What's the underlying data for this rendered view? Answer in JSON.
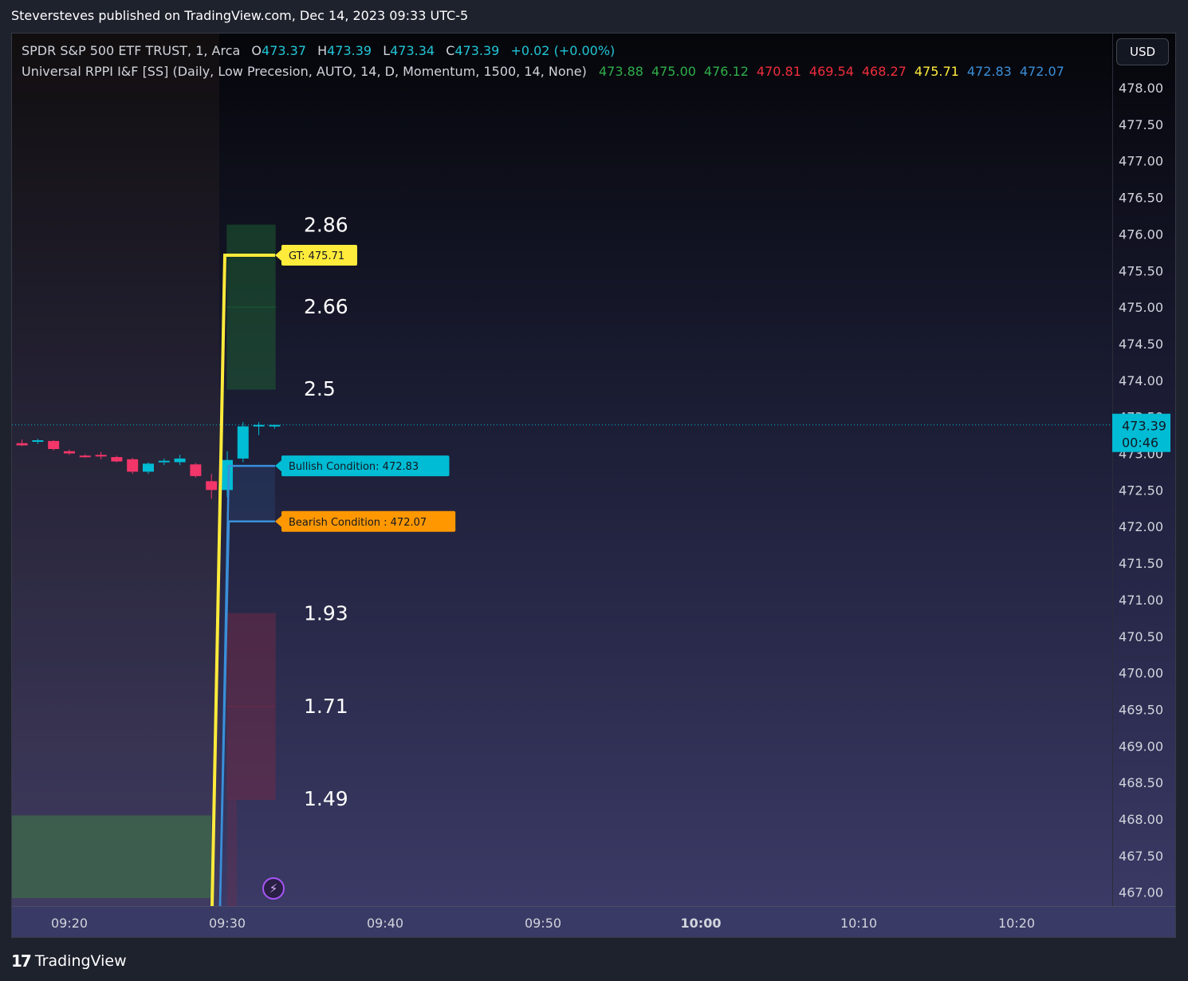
{
  "header": "Steversteves published on TradingView.com, Dec 14, 2023 09:33 UTC-5",
  "footer_brand": "TradingView",
  "footer_logo": "17",
  "currency_button": "USD",
  "legend": {
    "symbol": "SPDR S&P 500 ETF TRUST, 1, Arca",
    "open_label": "O",
    "open": "473.37",
    "high_label": "H",
    "high": "473.39",
    "low_label": "L",
    "low": "473.34",
    "close_label": "C",
    "close": "473.39",
    "change": "+0.02 (+0.00%)",
    "indicator_name": "Universal RPPI I&F [SS] (Daily, Low Precesion, AUTO, 14, D, Momentum, 1500, 14, None)",
    "indicator_values": [
      {
        "text": "473.88",
        "color": "#2fae4a"
      },
      {
        "text": "475.00",
        "color": "#2fae4a"
      },
      {
        "text": "476.12",
        "color": "#2fae4a"
      },
      {
        "text": "470.81",
        "color": "#ef2d3c"
      },
      {
        "text": "469.54",
        "color": "#ef2d3c"
      },
      {
        "text": "468.27",
        "color": "#ef2d3c"
      },
      {
        "text": "475.71",
        "color": "#ffeb3b"
      },
      {
        "text": "472.83",
        "color": "#3a8fd9"
      },
      {
        "text": "472.07",
        "color": "#3a8fd9"
      }
    ]
  },
  "last_price": {
    "price": "473.39",
    "countdown": "00:46",
    "value": 473.39
  },
  "chart_data": {
    "type": "candlestick",
    "ylim": [
      466.8,
      478.35
    ],
    "y_ticks": [
      478.0,
      477.5,
      477.0,
      476.5,
      476.0,
      475.5,
      475.0,
      474.5,
      474.0,
      473.5,
      473.0,
      472.5,
      472.0,
      471.5,
      471.0,
      470.5,
      470.0,
      469.5,
      469.0,
      468.5,
      468.0,
      467.5,
      467.0
    ],
    "y_tick_labels": [
      "478.00",
      "477.50",
      "477.00",
      "476.50",
      "476.00",
      "475.50",
      "475.00",
      "474.50",
      "474.00",
      "473.50",
      "473.00",
      "472.50",
      "472.00",
      "471.50",
      "471.00",
      "470.50",
      "470.00",
      "469.50",
      "469.00",
      "468.50",
      "468.00",
      "467.50",
      "467.00"
    ],
    "x_ticks": [
      "09:20",
      "09:30",
      "09:40",
      "09:50",
      "10:00",
      "10:10",
      "10:20"
    ],
    "bold_x_tick": "10:00",
    "candles": [
      {
        "t": "09:17",
        "o": 473.14,
        "h": 473.19,
        "l": 473.1,
        "c": 473.11
      },
      {
        "t": "09:18",
        "o": 473.16,
        "h": 473.2,
        "l": 473.13,
        "c": 473.18
      },
      {
        "t": "09:19",
        "o": 473.17,
        "h": 473.18,
        "l": 473.04,
        "c": 473.06
      },
      {
        "t": "09:20",
        "o": 473.03,
        "h": 473.05,
        "l": 472.98,
        "c": 473.0
      },
      {
        "t": "09:21",
        "o": 472.97,
        "h": 472.99,
        "l": 472.94,
        "c": 472.95
      },
      {
        "t": "09:22",
        "o": 472.98,
        "h": 473.02,
        "l": 472.92,
        "c": 472.96
      },
      {
        "t": "09:23",
        "o": 472.95,
        "h": 472.97,
        "l": 472.88,
        "c": 472.89
      },
      {
        "t": "09:24",
        "o": 472.92,
        "h": 472.94,
        "l": 472.72,
        "c": 472.75
      },
      {
        "t": "09:25",
        "o": 472.75,
        "h": 472.88,
        "l": 472.72,
        "c": 472.86
      },
      {
        "t": "09:26",
        "o": 472.88,
        "h": 472.93,
        "l": 472.84,
        "c": 472.9
      },
      {
        "t": "09:27",
        "o": 472.88,
        "h": 472.98,
        "l": 472.84,
        "c": 472.93
      },
      {
        "t": "09:28",
        "o": 472.85,
        "h": 472.87,
        "l": 472.67,
        "c": 472.69
      },
      {
        "t": "09:29",
        "o": 472.62,
        "h": 472.72,
        "l": 472.38,
        "c": 472.5
      },
      {
        "t": "09:30",
        "o": 472.5,
        "h": 473.03,
        "l": 472.4,
        "c": 472.91
      },
      {
        "t": "09:31",
        "o": 472.93,
        "h": 473.43,
        "l": 472.88,
        "c": 473.37
      },
      {
        "t": "09:32",
        "o": 473.38,
        "h": 473.43,
        "l": 473.25,
        "c": 473.39
      },
      {
        "t": "09:33",
        "o": 473.37,
        "h": 473.39,
        "l": 473.34,
        "c": 473.39
      }
    ],
    "zones": [
      {
        "label": "2.86",
        "top": 476.12,
        "bottom": 475.0,
        "color": "#1f6b35"
      },
      {
        "label": "2.66",
        "top": 475.0,
        "bottom": 473.88,
        "color": "#1f6b35"
      },
      {
        "label": "1.93",
        "top": 470.81,
        "bottom": 469.54,
        "color": "#7a2a45"
      },
      {
        "label": "1.71",
        "top": 469.54,
        "bottom": 468.27,
        "color": "#7a2a45"
      }
    ],
    "level_labels": [
      {
        "text": "2.86",
        "price": 476.12
      },
      {
        "text": "2.66",
        "price": 475.0
      },
      {
        "text": "2.5",
        "price": 473.88
      },
      {
        "text": "1.93",
        "price": 470.81
      },
      {
        "text": "1.71",
        "price": 469.54
      },
      {
        "text": "1.49",
        "price": 468.27
      }
    ],
    "lines": [
      {
        "name": "GT",
        "price": 475.71,
        "color": "#ffeb3b",
        "label": "GT: 475.71",
        "label_bg": "#ffeb3b",
        "label_color": "#131722"
      },
      {
        "name": "Bullish Condition",
        "price": 472.83,
        "color": "#3a8fd9",
        "label": "Bullish Condition: 472.83",
        "label_bg": "#00bcd4",
        "label_color": "#131722"
      },
      {
        "name": "Bearish Condition",
        "price": 472.07,
        "color": "#3a8fd9",
        "label": "Bearish Condition : 472.07",
        "label_bg": "#ff9800",
        "label_color": "#131722"
      }
    ],
    "colors": {
      "up": "#00bcd4",
      "down": "#f23669",
      "price_line": "#00bcd4"
    }
  }
}
